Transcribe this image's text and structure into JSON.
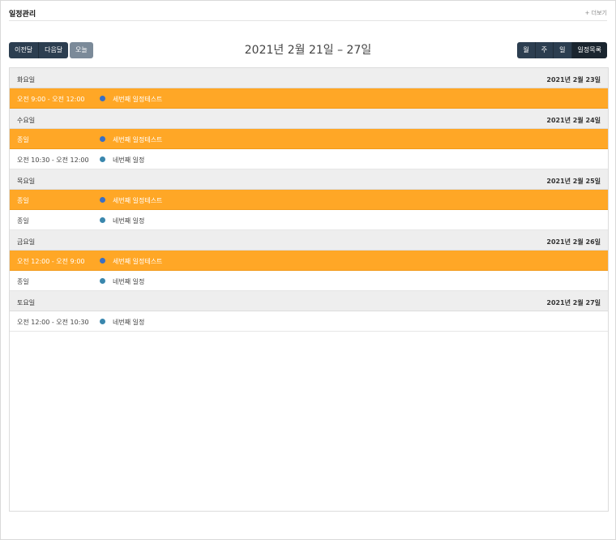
{
  "header": {
    "title": "일정관리",
    "more": "+ 더보기"
  },
  "toolbar": {
    "prev": "이전달",
    "next": "다음달",
    "today": "오늘",
    "range": "2021년 2월 21일 – 27일",
    "views": [
      "월",
      "주",
      "일",
      "일정목록"
    ],
    "active_view": "일정목록"
  },
  "colors": {
    "highlight": "#ffa726",
    "button": "#2c3e50",
    "dot": "#3a87ad"
  },
  "days": [
    {
      "name": "화요일",
      "date": "2021년 2월 23일",
      "events": [
        {
          "time": "오전 9:00 - 오전 12:00",
          "title": "세번째 일정테스트",
          "highlight": true
        }
      ]
    },
    {
      "name": "수요일",
      "date": "2021년 2월 24일",
      "events": [
        {
          "time": "종일",
          "title": "세번째 일정테스트",
          "highlight": true
        },
        {
          "time": "오전 10:30 - 오전 12:00",
          "title": "네번째 일정",
          "highlight": false
        }
      ]
    },
    {
      "name": "목요일",
      "date": "2021년 2월 25일",
      "events": [
        {
          "time": "종일",
          "title": "세번째 일정테스트",
          "highlight": true
        },
        {
          "time": "종일",
          "title": "네번째 일정",
          "highlight": false
        }
      ]
    },
    {
      "name": "금요일",
      "date": "2021년 2월 26일",
      "events": [
        {
          "time": "오전 12:00 - 오전 9:00",
          "title": "세번째 일정테스트",
          "highlight": true
        },
        {
          "time": "종일",
          "title": "네번째 일정",
          "highlight": false
        }
      ]
    },
    {
      "name": "토요일",
      "date": "2021년 2월 27일",
      "events": [
        {
          "time": "오전 12:00 - 오전 10:30",
          "title": "네번째 일정",
          "highlight": false
        }
      ]
    }
  ]
}
